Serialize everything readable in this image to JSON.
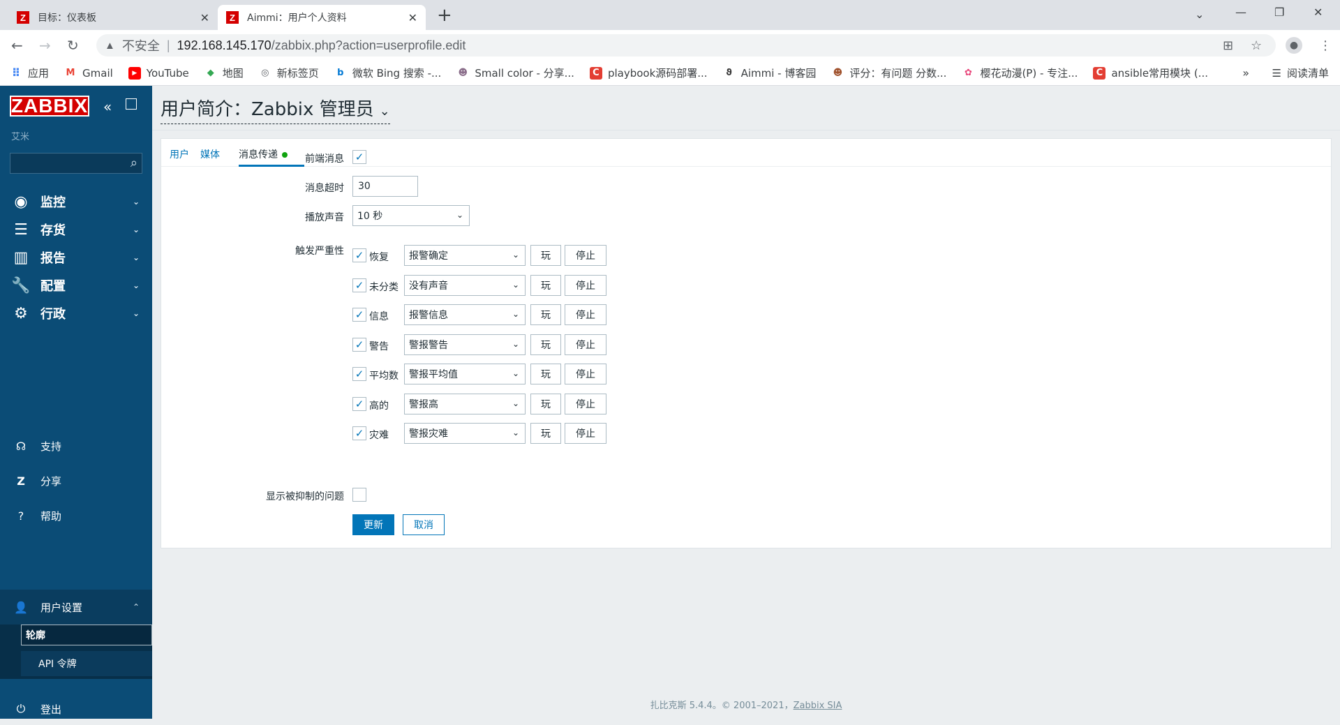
{
  "browser": {
    "tabs": [
      {
        "title": "目标：仪表板",
        "icon": "zabbix-favicon"
      },
      {
        "title": "Aimmi：用户个人资料",
        "icon": "zabbix-favicon"
      }
    ],
    "insecure_label": "不安全",
    "url_host": "192.168.145.170",
    "url_path": "/zabbix.php?action=userprofile.edit",
    "bookmarks": [
      {
        "label": "应用",
        "icon": "apps-grid-icon"
      },
      {
        "label": "Gmail",
        "icon": "gmail-icon"
      },
      {
        "label": "YouTube",
        "icon": "youtube-icon"
      },
      {
        "label": "地图",
        "icon": "maps-icon"
      },
      {
        "label": "新标签页",
        "icon": "globe-icon"
      },
      {
        "label": "微软 Bing 搜索 -...",
        "icon": "bing-icon"
      },
      {
        "label": "Small color - 分享...",
        "icon": "avatar-icon"
      },
      {
        "label": "playbook源码部署...",
        "icon": "csdn-icon"
      },
      {
        "label": "Aimmi - 博客园",
        "icon": "cnblogs-icon"
      },
      {
        "label": "评分：有问题 分数...",
        "icon": "avatar-icon"
      },
      {
        "label": "樱花动漫(P) - 专注...",
        "icon": "flower-icon"
      },
      {
        "label": "ansible常用模块 (...",
        "icon": "csdn-icon"
      }
    ],
    "more_label": "»",
    "reading_list": "阅读清单"
  },
  "sidebar": {
    "logo": "ZABBIX",
    "server_name": "艾米",
    "search_placeholder": "",
    "menu": [
      {
        "label": "监控",
        "icon": "eye-icon"
      },
      {
        "label": "存货",
        "icon": "list-icon"
      },
      {
        "label": "报告",
        "icon": "bar-chart-icon"
      },
      {
        "label": "配置",
        "icon": "wrench-icon"
      },
      {
        "label": "行政",
        "icon": "gear-icon"
      }
    ],
    "bottom": [
      {
        "label": "支持",
        "icon": "headset-icon"
      },
      {
        "label": "分享",
        "icon": "share-z-icon"
      },
      {
        "label": "帮助",
        "icon": "help-icon"
      },
      {
        "label": "用户设置",
        "icon": "user-icon"
      }
    ],
    "user_submenu": [
      "轮廓",
      "API 令牌"
    ],
    "logout": "登出"
  },
  "page": {
    "title": "用户简介：Zabbix 管理员",
    "tabs": [
      "用户",
      "媒体",
      "消息传递"
    ],
    "active_tab": "消息传递"
  },
  "form": {
    "frontend_messaging_label": "前端消息",
    "frontend_messaging_checked": true,
    "timeout_label": "消息超时",
    "timeout_value": "30",
    "play_sound_label": "播放声音",
    "play_sound_value": "10 秒",
    "trigger_severity_label": "触发严重性",
    "severities": [
      {
        "label": "恢复",
        "checked": true,
        "sound": "报警确定"
      },
      {
        "label": "未分类",
        "checked": true,
        "sound": "没有声音"
      },
      {
        "label": "信息",
        "checked": true,
        "sound": "报警信息"
      },
      {
        "label": "警告",
        "checked": true,
        "sound": "警报警告"
      },
      {
        "label": "平均数",
        "checked": true,
        "sound": "警报平均值"
      },
      {
        "label": "高的",
        "checked": true,
        "sound": "警报高"
      },
      {
        "label": "灾难",
        "checked": true,
        "sound": "警报灾难"
      }
    ],
    "play_label": "玩",
    "stop_label": "停止",
    "suppressed_label": "显示被抑制的问题",
    "suppressed_checked": false,
    "update_label": "更新",
    "cancel_label": "取消"
  },
  "footer": {
    "text": "扎比克斯 5.4.4。© 2001–2021，",
    "link": "Zabbix SIA"
  },
  "colors": {
    "sidebar_bg": "#0b4c76",
    "logo_red": "#d40000",
    "accent_blue": "#0275b8",
    "status_green": "#10a30f"
  }
}
